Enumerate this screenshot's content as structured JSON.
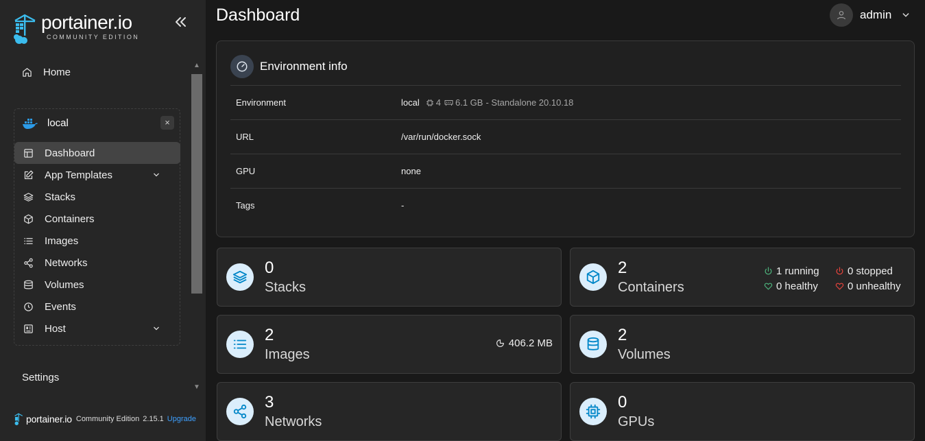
{
  "brand": {
    "name": "portainer.io",
    "edition": "COMMUNITY EDITION"
  },
  "sidebar": {
    "home_label": "Home",
    "environment": {
      "name": "local",
      "close_label": "×"
    },
    "menu": [
      {
        "label": "Dashboard",
        "icon": "dashboard-icon",
        "active": true
      },
      {
        "label": "App Templates",
        "icon": "edit-icon",
        "expandable": true
      },
      {
        "label": "Stacks",
        "icon": "layers-icon"
      },
      {
        "label": "Containers",
        "icon": "box-icon"
      },
      {
        "label": "Images",
        "icon": "list-icon"
      },
      {
        "label": "Networks",
        "icon": "share-icon"
      },
      {
        "label": "Volumes",
        "icon": "database-icon"
      },
      {
        "label": "Events",
        "icon": "clock-icon"
      },
      {
        "label": "Host",
        "icon": "server-icon",
        "expandable": true
      }
    ],
    "settings_label": "Settings",
    "footer": {
      "brand": "portainer.io",
      "edition": "Community Edition",
      "version": "2.15.1",
      "upgrade": "Upgrade"
    }
  },
  "header": {
    "title": "Dashboard",
    "user": "admin"
  },
  "env_info": {
    "title": "Environment info",
    "rows": [
      {
        "key": "Environment",
        "name": "local",
        "cpu": "4",
        "memory": "6.1 GB",
        "type": "- Standalone 20.10.18"
      },
      {
        "key": "URL",
        "value": "/var/run/docker.sock"
      },
      {
        "key": "GPU",
        "value": "none"
      },
      {
        "key": "Tags",
        "value": "-"
      }
    ]
  },
  "stats": {
    "stacks": {
      "count": "0",
      "label": "Stacks"
    },
    "containers": {
      "count": "2",
      "label": "Containers",
      "running": "1 running",
      "stopped": "0 stopped",
      "healthy": "0 healthy",
      "unhealthy": "0 unhealthy"
    },
    "images": {
      "count": "2",
      "label": "Images",
      "size": "406.2 MB"
    },
    "volumes": {
      "count": "2",
      "label": "Volumes"
    },
    "networks": {
      "count": "3",
      "label": "Networks"
    },
    "gpus": {
      "count": "0",
      "label": "GPUs"
    }
  },
  "colors": {
    "accent": "#0086c8",
    "icon_bg": "#dbeefc",
    "running": "#4caf7a",
    "stopped": "#e0433c",
    "link": "#3ea0ff"
  }
}
